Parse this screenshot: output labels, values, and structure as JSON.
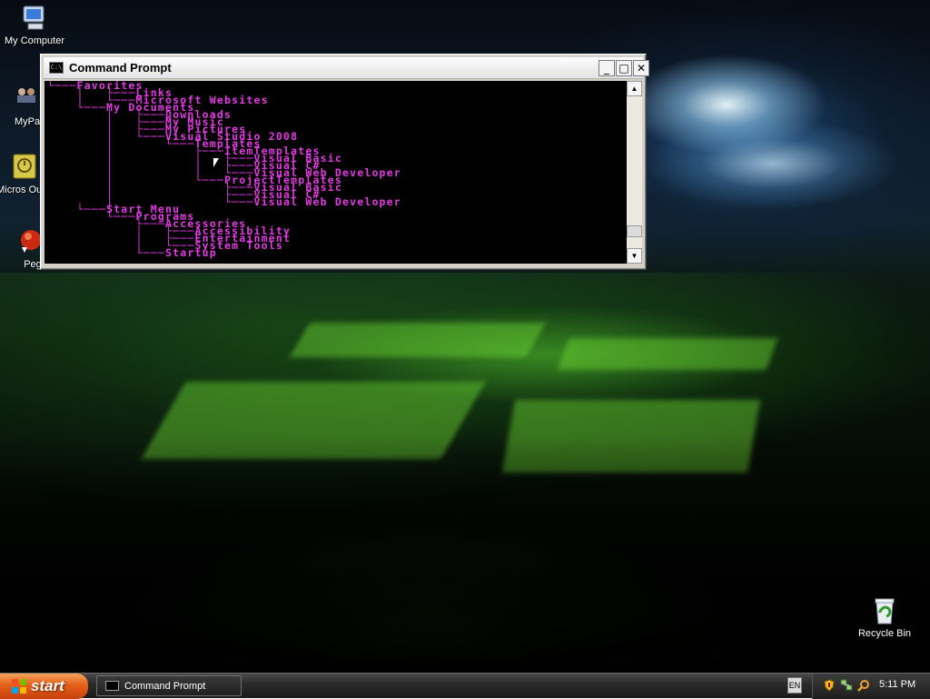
{
  "desktop": {
    "icons": [
      {
        "label": "My Computer"
      },
      {
        "label": "MyPa"
      },
      {
        "label": "Micros Outlo"
      },
      {
        "label": "Peg"
      },
      {
        "label": "Recycle Bin"
      }
    ]
  },
  "window": {
    "title": "Command Prompt",
    "title_icon_text": "C:\\",
    "buttons": {
      "minimize": "_",
      "maximize": "□",
      "close": "✕"
    },
    "console_color": "#e43ae4",
    "console_lines": [
      "└───Favorites",
      "    │   └───Links",
      "    │   └───Microsoft Websites",
      "    └───My Documents",
      "        │   └───Downloads",
      "        │   └───My Music",
      "        │   └───My Pictures",
      "        │   └───Visual Studio 2008",
      "        │       └───Templates",
      "        │           └───ItemTemplates",
      "        │           │   └───Visual Basic",
      "        │           │   └───Visual C#",
      "        │           │   └───Visual Web Developer",
      "        │           └───ProjectTemplates",
      "        │               └───Visual Basic",
      "        │               └───Visual C#",
      "        │               └───Visual Web Developer",
      "    └───Start Menu",
      "        └───Programs",
      "            └───Accessories",
      "            │   └───Accessibility",
      "            │   └───Entertainment",
      "            │   └───System Tools",
      "            └───Startup"
    ],
    "scrollbar": {
      "up": "▲",
      "down": "▼",
      "position": 0.92
    }
  },
  "taskbar": {
    "start_label": "start",
    "tasks": [
      {
        "label": "Command Prompt",
        "icon": "cmd-icon"
      }
    ],
    "language": "EN",
    "tray_icons": [
      "security-shield-icon",
      "network-icon",
      "search-icon"
    ],
    "clock": "5:11 PM"
  },
  "colors": {
    "start_orange": "#e4601a",
    "console_magenta": "#e43ae4"
  }
}
